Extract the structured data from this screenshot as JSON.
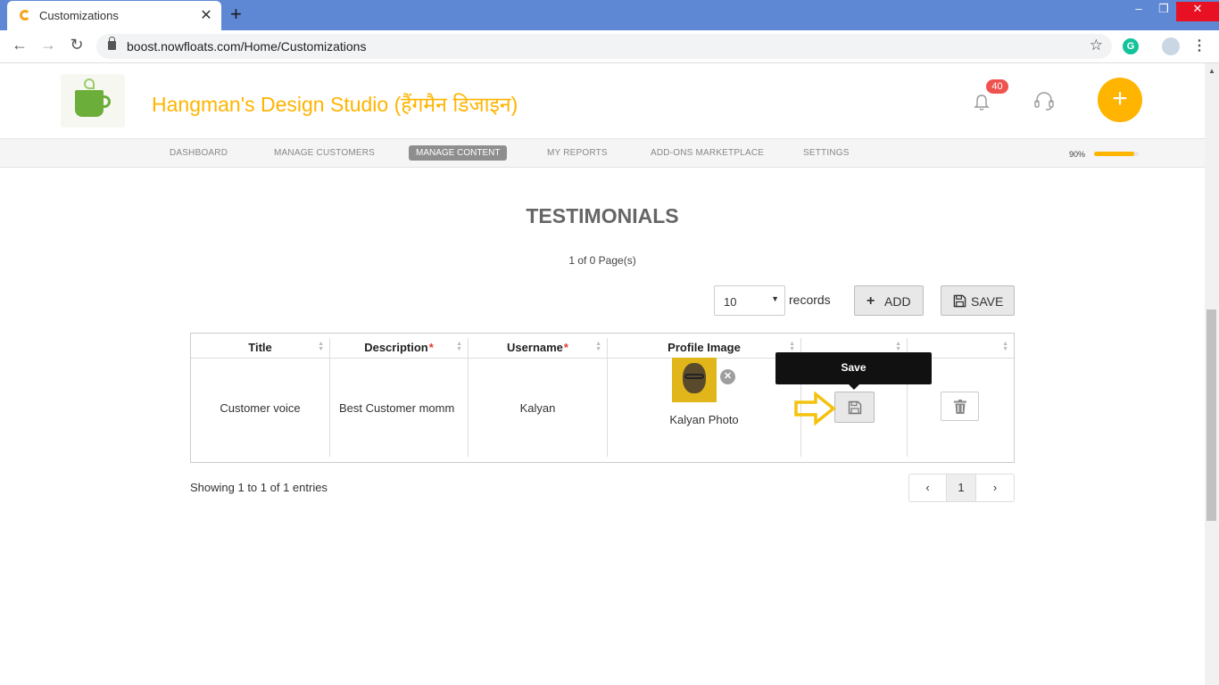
{
  "browser": {
    "tab_title": "Customizations",
    "url": "boost.nowfloats.com/Home/Customizations",
    "window_controls": {
      "minimize": "–",
      "maximize": "❐",
      "close": "✕"
    }
  },
  "header": {
    "brand": "Hangman's Design Studio (हैंगमैन डिजाइन)",
    "notification_count": "40",
    "icons": {
      "notifications": "bell-icon",
      "support": "headset-icon",
      "add": "plus-icon"
    },
    "accent_color": "#ffb400"
  },
  "nav": {
    "items": [
      "DASHBOARD",
      "MANAGE CUSTOMERS",
      "MANAGE CONTENT",
      "MY REPORTS",
      "ADD-ONS MARKETPLACE",
      "SETTINGS"
    ],
    "active": "MANAGE CONTENT",
    "progress_label": "90%",
    "progress_fraction": 0.9
  },
  "page": {
    "heading": "TESTIMONIALS",
    "page_count": "1 of 0 Page(s)",
    "records_value": "10",
    "records_label": "records",
    "add_label": "ADD",
    "save_label": "SAVE"
  },
  "table": {
    "columns": [
      "Title",
      "Description",
      "Username",
      "Profile Image",
      "",
      ""
    ],
    "required_marker": "*",
    "rows": [
      {
        "title": "Customer voice",
        "description": "Best Customer momm",
        "username": "Kalyan",
        "profile_caption": "Kalyan Photo"
      }
    ]
  },
  "tooltip": {
    "text": "Save"
  },
  "footer": {
    "entries_info": "Showing 1 to 1 of 1 entries",
    "pagination": {
      "prev": "‹",
      "current": "1",
      "next": "›"
    }
  }
}
